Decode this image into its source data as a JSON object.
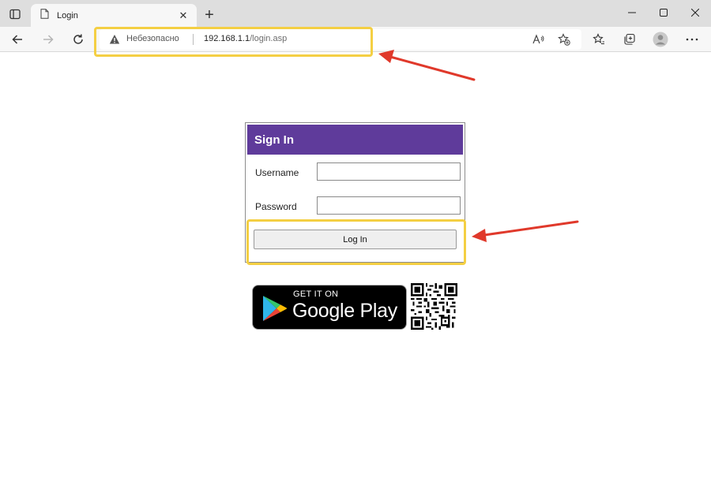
{
  "browser": {
    "tab_title": "Login",
    "new_tab_symbol": "+",
    "tab_close_symbol": "✕"
  },
  "address_bar": {
    "security_text": "Небезопасно",
    "url_host": "192.168.1.1",
    "url_path": "/login.asp"
  },
  "icons": [
    "tab-actions-icon",
    "page-icon",
    "close-icon",
    "minimize-icon",
    "maximize-icon",
    "back-icon",
    "forward-icon",
    "refresh-icon",
    "warning-icon",
    "read-aloud-icon",
    "favorite-add-icon",
    "favorites-icon",
    "collections-icon",
    "profile-icon",
    "more-icon",
    "google-play-icon",
    "qr-code-icon"
  ],
  "login": {
    "title": "Sign In",
    "username_label": "Username",
    "password_label": "Password",
    "username_value": "",
    "password_value": "",
    "submit_label": "Log In"
  },
  "store_badge": {
    "small_text": "GET IT ON",
    "big_text": "Google Play"
  },
  "colors": {
    "header_purple": "#5f3b9b",
    "highlight_yellow": "#f4cf43",
    "arrow_red": "#e0392b"
  }
}
